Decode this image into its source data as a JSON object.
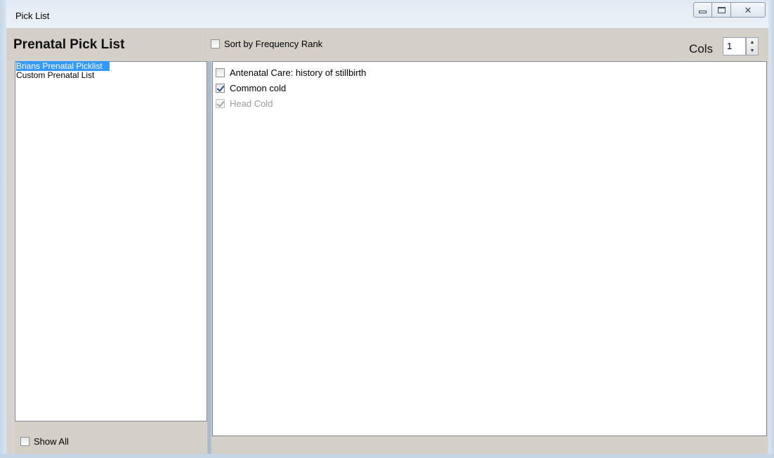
{
  "window": {
    "title": "Pick List",
    "controls": {
      "minimize": "minimize",
      "maximize": "maximize",
      "close": "close"
    }
  },
  "left_pane": {
    "title": "Prenatal Pick List",
    "lists": [
      {
        "label": "Brians Prenatal Picklist",
        "selected": true
      },
      {
        "label": "Custom Prenatal List",
        "selected": false
      }
    ],
    "show_all_label": "Show All",
    "show_all_checked": false
  },
  "toolbar": {
    "sort_label": "Sort by Frequency Rank",
    "sort_checked": false,
    "cols_label": "Cols",
    "cols_value": "1"
  },
  "pick_items": [
    {
      "label": "Antenatal Care: history of stillbirth",
      "checked": false,
      "disabled": false
    },
    {
      "label": "Common cold",
      "checked": true,
      "disabled": false
    },
    {
      "label": "Head Cold",
      "checked": true,
      "disabled": true
    }
  ],
  "colors": {
    "selection": "#3399ff",
    "panel": "#d4d0c8",
    "checkmark": "#2a4e86"
  }
}
